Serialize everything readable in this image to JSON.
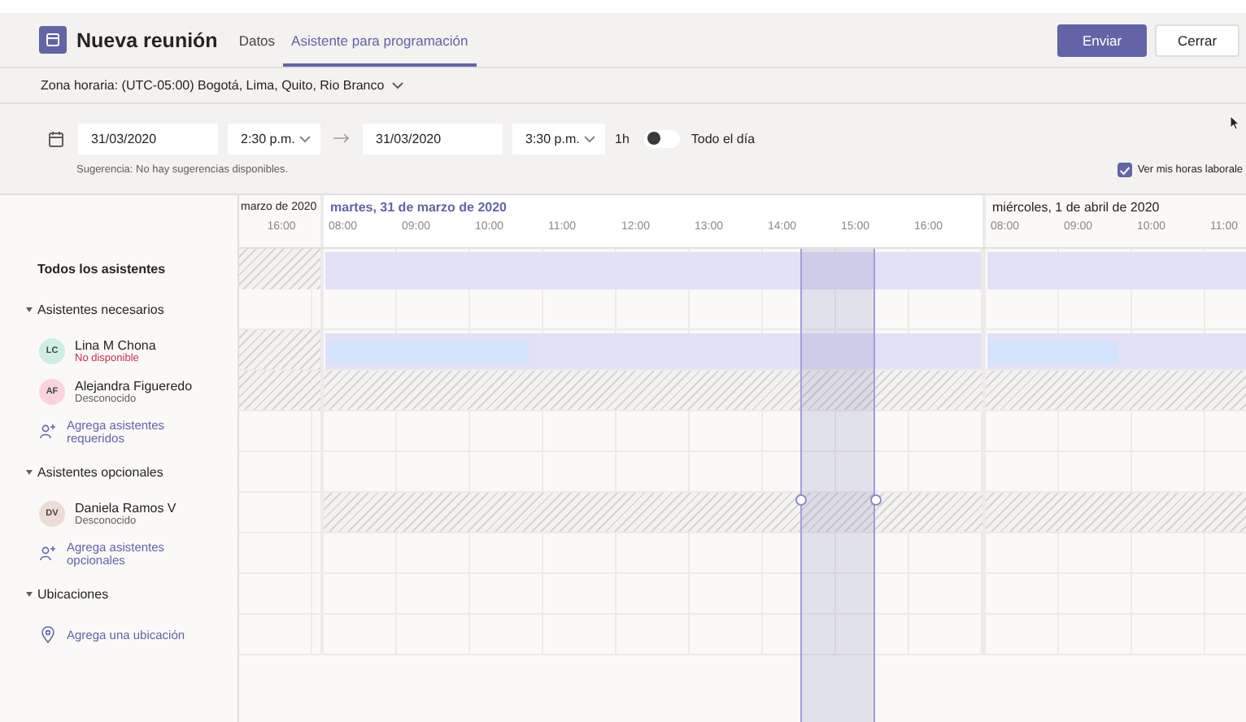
{
  "header": {
    "title": "Nueva reunión",
    "tabs": [
      {
        "label": "Datos",
        "selected": false
      },
      {
        "label": "Asistente para programación",
        "selected": true
      }
    ],
    "buttons": [
      {
        "label": "Enviar",
        "kind": "primary"
      },
      {
        "label": "Cerrar",
        "kind": "secondary"
      }
    ]
  },
  "timezone": "Zona horaria: (UTC-05:00) Bogotá, Lima, Quito, Rio Branco",
  "schedule": {
    "start_date": "31/03/2020",
    "start_time": "2:30 p.m.",
    "end_date": "31/03/2020",
    "end_time": "3:30 p.m.",
    "duration": "1h",
    "all_day": {
      "label": "Todo el día",
      "on": false
    },
    "suggestion": "Sugerencia: No hay sugerencias disponibles.",
    "working_hours": {
      "label": "Ver mis horas laborale",
      "checked": true
    }
  },
  "days": [
    {
      "label": "marzo de 2020",
      "selected": false,
      "hours": [
        "16:00"
      ]
    },
    {
      "label": "martes, 31 de marzo de 2020",
      "selected": true,
      "hours": [
        "08:00",
        "09:00",
        "10:00",
        "11:00",
        "12:00",
        "13:00",
        "14:00",
        "15:00",
        "16:00"
      ]
    },
    {
      "label": "miércoles, 1 de abril de 2020",
      "selected": false,
      "hours": [
        "08:00",
        "09:00",
        "10:00",
        "11:00"
      ]
    }
  ],
  "rows": [
    {
      "kind": "all",
      "label": "Todos los asistentes",
      "timeline": [
        {
          "kind": "unknown"
        },
        {
          "kind": "working"
        },
        {
          "kind": "working"
        }
      ]
    },
    {
      "kind": "section",
      "label": "Asistentes necesarios",
      "expanded": true,
      "timeline": [
        {
          "kind": "empty"
        },
        {
          "kind": "empty"
        },
        {
          "kind": "empty"
        }
      ]
    },
    {
      "kind": "person",
      "initials": "LC",
      "name": "Lina M Chona",
      "status": "No disponible",
      "unavailable": true,
      "color": "#cfeee3",
      "timeline": [
        {
          "kind": "unknown"
        },
        {
          "kind": "busy"
        },
        {
          "kind": "busy"
        }
      ]
    },
    {
      "kind": "person",
      "initials": "AF",
      "name": "Alejandra Figueredo",
      "status": "Desconocido",
      "unavailable": false,
      "color": "#fbd3dc",
      "timeline": [
        {
          "kind": "unknown"
        },
        {
          "kind": "unknown"
        },
        {
          "kind": "unknown"
        }
      ]
    },
    {
      "kind": "add",
      "label": "Agrega asistentes requeridos",
      "timeline": [
        {
          "kind": "empty"
        },
        {
          "kind": "empty"
        },
        {
          "kind": "empty"
        }
      ]
    },
    {
      "kind": "section",
      "label": "Asistentes opcionales",
      "expanded": true,
      "timeline": [
        {
          "kind": "empty"
        },
        {
          "kind": "empty"
        },
        {
          "kind": "empty"
        }
      ]
    },
    {
      "kind": "person",
      "initials": "DV",
      "name": "Daniela Ramos V",
      "status": "Desconocido",
      "unavailable": false,
      "color": "#ecdcd6",
      "timeline": [
        {
          "kind": "empty"
        },
        {
          "kind": "unknown"
        },
        {
          "kind": "unknown"
        }
      ]
    },
    {
      "kind": "add",
      "label": "Agrega asistentes opcionales",
      "timeline": [
        {
          "kind": "empty"
        },
        {
          "kind": "empty"
        },
        {
          "kind": "empty"
        }
      ]
    },
    {
      "kind": "section",
      "label": "Ubicaciones",
      "expanded": true,
      "timeline": [
        {
          "kind": "empty"
        },
        {
          "kind": "empty"
        },
        {
          "kind": "empty"
        }
      ]
    },
    {
      "kind": "location",
      "label": "Agrega una ubicación",
      "timeline": [
        {
          "kind": "empty"
        },
        {
          "kind": "empty"
        },
        {
          "kind": "empty"
        }
      ]
    }
  ]
}
